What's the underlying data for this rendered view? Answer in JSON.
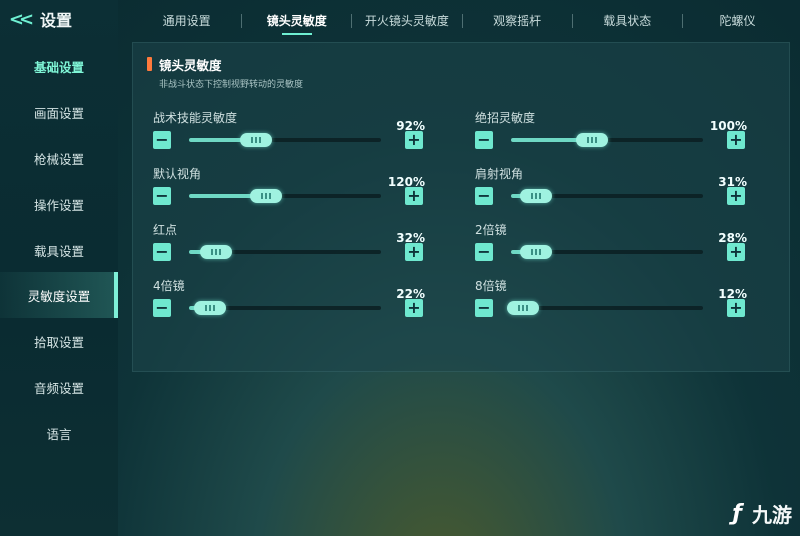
{
  "sidebar": {
    "back_icon": "double-chevron-left-icon",
    "title": "设置",
    "items": [
      {
        "label": "基础设置",
        "state": "highlight"
      },
      {
        "label": "画面设置"
      },
      {
        "label": "枪械设置"
      },
      {
        "label": "操作设置"
      },
      {
        "label": "载具设置"
      },
      {
        "label": "灵敏度设置",
        "state": "active"
      },
      {
        "label": "拾取设置"
      },
      {
        "label": "音频设置"
      },
      {
        "label": "语言"
      }
    ]
  },
  "tabs": [
    {
      "label": "通用设置"
    },
    {
      "label": "镜头灵敏度",
      "active": true
    },
    {
      "label": "开火镜头灵敏度"
    },
    {
      "label": "观察摇杆"
    },
    {
      "label": "载具状态"
    },
    {
      "label": "陀螺仪"
    }
  ],
  "section": {
    "title": "镜头灵敏度",
    "description": "非战斗状态下控制视野转动的灵敏度"
  },
  "sliders": [
    {
      "label": "战术技能灵敏度",
      "value": "92%",
      "fill": 0.35
    },
    {
      "label": "绝招灵敏度",
      "value": "100%",
      "fill": 0.42
    },
    {
      "label": "默认视角",
      "value": "120%",
      "fill": 0.4
    },
    {
      "label": "肩射视角",
      "value": "31%",
      "fill": 0.13
    },
    {
      "label": "红点",
      "value": "32%",
      "fill": 0.14
    },
    {
      "label": "2倍镜",
      "value": "28%",
      "fill": 0.13
    },
    {
      "label": "4倍镜",
      "value": "22%",
      "fill": 0.11
    },
    {
      "label": "8倍镜",
      "value": "12%",
      "fill": 0.06
    }
  ],
  "buttons": {
    "minus": "−",
    "plus": "+"
  },
  "watermark": {
    "text": "九游",
    "icon": "9game-logo-icon"
  },
  "colors": {
    "accent": "#6fe8cf",
    "section_marker": "#ff7a3c"
  }
}
